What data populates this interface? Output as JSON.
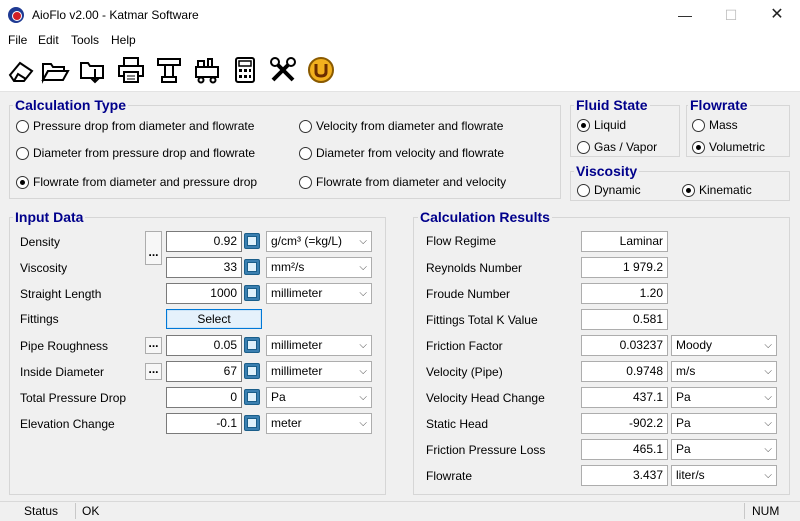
{
  "window": {
    "title": "AioFlo  v2.00 - Katmar Software",
    "minimize": "—",
    "maximize": "☐",
    "close": "✕"
  },
  "menu": {
    "file": "File",
    "edit": "Edit",
    "tools": "Tools",
    "help": "Help"
  },
  "calc_type": {
    "title": "Calculation Type",
    "options": [
      "Pressure drop from diameter and flowrate",
      "Diameter from pressure drop and flowrate",
      "Flowrate from diameter and pressure drop",
      "Velocity from diameter and flowrate",
      "Diameter from velocity and flowrate",
      "Flowrate from diameter and velocity"
    ],
    "selected": 2
  },
  "fluid_state": {
    "title": "Fluid State",
    "liquid": "Liquid",
    "gas": "Gas / Vapor",
    "selected": "liquid"
  },
  "flowrate_group": {
    "title": "Flowrate",
    "mass": "Mass",
    "volumetric": "Volumetric",
    "selected": "volumetric"
  },
  "viscosity_group": {
    "title": "Viscosity",
    "dynamic": "Dynamic",
    "kinematic": "Kinematic",
    "selected": "kinematic"
  },
  "input": {
    "title": "Input Data",
    "density": {
      "label": "Density",
      "value": "0.92",
      "unit": "g/cm³ (=kg/L)"
    },
    "viscosity": {
      "label": "Viscosity",
      "value": "33",
      "unit": "mm²/s"
    },
    "straight_length": {
      "label": "Straight Length",
      "value": "1000",
      "unit": "millimeter"
    },
    "fittings": {
      "label": "Fittings",
      "button": "Select"
    },
    "roughness": {
      "label": "Pipe Roughness",
      "value": "0.05",
      "unit": "millimeter"
    },
    "inside_diameter": {
      "label": "Inside Diameter",
      "value": "67",
      "unit": "millimeter"
    },
    "pressure_drop": {
      "label": "Total Pressure Drop",
      "value": "0",
      "unit": "Pa"
    },
    "elevation": {
      "label": "Elevation Change",
      "value": "-0.1",
      "unit": "meter"
    },
    "dots": "..."
  },
  "results": {
    "title": "Calculation Results",
    "flow_regime": {
      "label": "Flow Regime",
      "value": "Laminar"
    },
    "reynolds": {
      "label": "Reynolds Number",
      "value": "1 979.2"
    },
    "froude": {
      "label": "Froude Number",
      "value": "1.20"
    },
    "fittings_k": {
      "label": "Fittings Total K Value",
      "value": "0.581"
    },
    "friction_factor": {
      "label": "Friction Factor",
      "value": "0.03237",
      "unit": "Moody"
    },
    "velocity": {
      "label": "Velocity (Pipe)",
      "value": "0.9748",
      "unit": "m/s"
    },
    "vel_head": {
      "label": "Velocity Head Change",
      "value": "437.1",
      "unit": "Pa"
    },
    "static_head": {
      "label": "Static Head",
      "value": "-902.2",
      "unit": "Pa"
    },
    "friction_loss": {
      "label": "Friction Pressure Loss",
      "value": "465.1",
      "unit": "Pa"
    },
    "flowrate": {
      "label": "Flowrate",
      "value": "3.437",
      "unit": "liter/s"
    }
  },
  "status": {
    "label": "Status",
    "value": "OK",
    "num": "NUM"
  }
}
